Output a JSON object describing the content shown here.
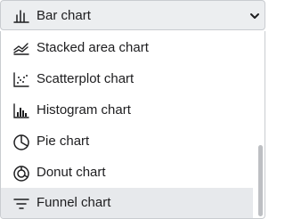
{
  "select": {
    "selected_label": "Bar chart",
    "icon": "bar-chart-icon",
    "chevron_icon": "chevron-down-icon"
  },
  "options": [
    {
      "label": "Stacked area chart",
      "icon": "area-chart-icon"
    },
    {
      "label": "Scatterplot chart",
      "icon": "scatterplot-icon"
    },
    {
      "label": "Histogram chart",
      "icon": "histogram-icon"
    },
    {
      "label": "Pie chart",
      "icon": "pie-chart-icon"
    },
    {
      "label": "Donut chart",
      "icon": "donut-chart-icon"
    },
    {
      "label": "Funnel chart",
      "icon": "funnel-chart-icon",
      "highlighted": true
    }
  ],
  "colors": {
    "text": "#1d1d1f",
    "select_bg": "#eceef0",
    "highlight_bg": "#e7e9ec",
    "border": "#c9ccd0",
    "scrollbar": "#bdbfc3"
  }
}
